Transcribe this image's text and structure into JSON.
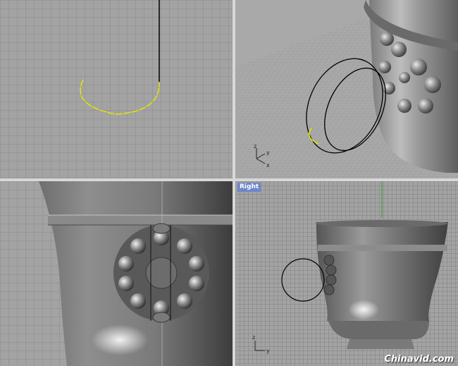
{
  "viewports": [
    {
      "id": "top-left",
      "view": ""
    },
    {
      "id": "top-right",
      "view": ""
    },
    {
      "id": "bottom-left",
      "view": ""
    },
    {
      "id": "bottom-right",
      "view": "Right"
    }
  ],
  "axis_labels": {
    "persp_x": "x",
    "persp_y": "y",
    "persp_z": "z",
    "right_z": "z",
    "right_y": "y"
  },
  "watermark": "Chinavid.com",
  "colors": {
    "viewport_bg": "#a3a3a3",
    "grid_line": "#8c8c8c",
    "selected_curve": "#e6e600",
    "curve": "#000000",
    "label_bg": "#6d87c9",
    "divider": "#e0e0e0"
  },
  "icons": [
    "axis-gizmo-icon"
  ]
}
